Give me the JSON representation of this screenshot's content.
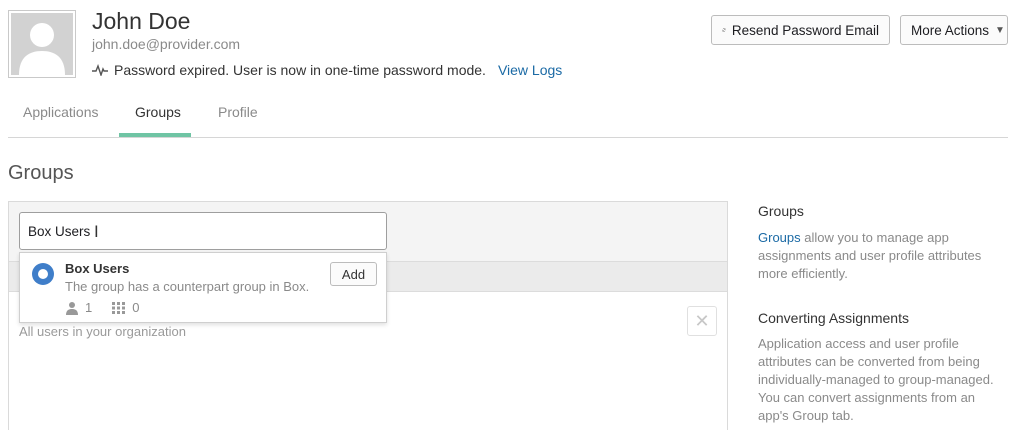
{
  "user": {
    "name": "John Doe",
    "email": "john.doe@provider.com",
    "status_text": "Password expired. User is now in one-time password mode.",
    "view_logs_label": "View Logs"
  },
  "actions": {
    "resend_label": "Resend Password Email",
    "more_actions_label": "More Actions"
  },
  "tabs": [
    {
      "label": "Applications",
      "active": false
    },
    {
      "label": "Groups",
      "active": true
    },
    {
      "label": "Profile",
      "active": false
    }
  ],
  "section_title": "Groups",
  "search": {
    "value": "Box Users"
  },
  "dropdown": {
    "group_name": "Box Users",
    "group_description": "The group has a counterpart group in Box.",
    "user_count": "1",
    "app_count": "0",
    "add_label": "Add"
  },
  "everyone_description": "All users in your organization",
  "aside": {
    "groups_heading": "Groups",
    "groups_link": "Groups",
    "groups_text": " allow you to manage app assignments and user profile attributes more efficiently.",
    "converting_heading": "Converting Assignments",
    "converting_text": "Application access and user profile attributes can be converted from being individually-managed to group-managed. You can convert assignments from an app's Group tab."
  },
  "colors": {
    "accent_tab": "#6fc4a4",
    "link": "#1b6aa5",
    "radio": "#3f7ec9"
  },
  "icons": [
    "user-avatar-icon",
    "pulse-icon",
    "refresh-icon",
    "caret-down-icon",
    "text-cursor-icon",
    "person-icon",
    "apps-grid-icon",
    "close-icon"
  ]
}
